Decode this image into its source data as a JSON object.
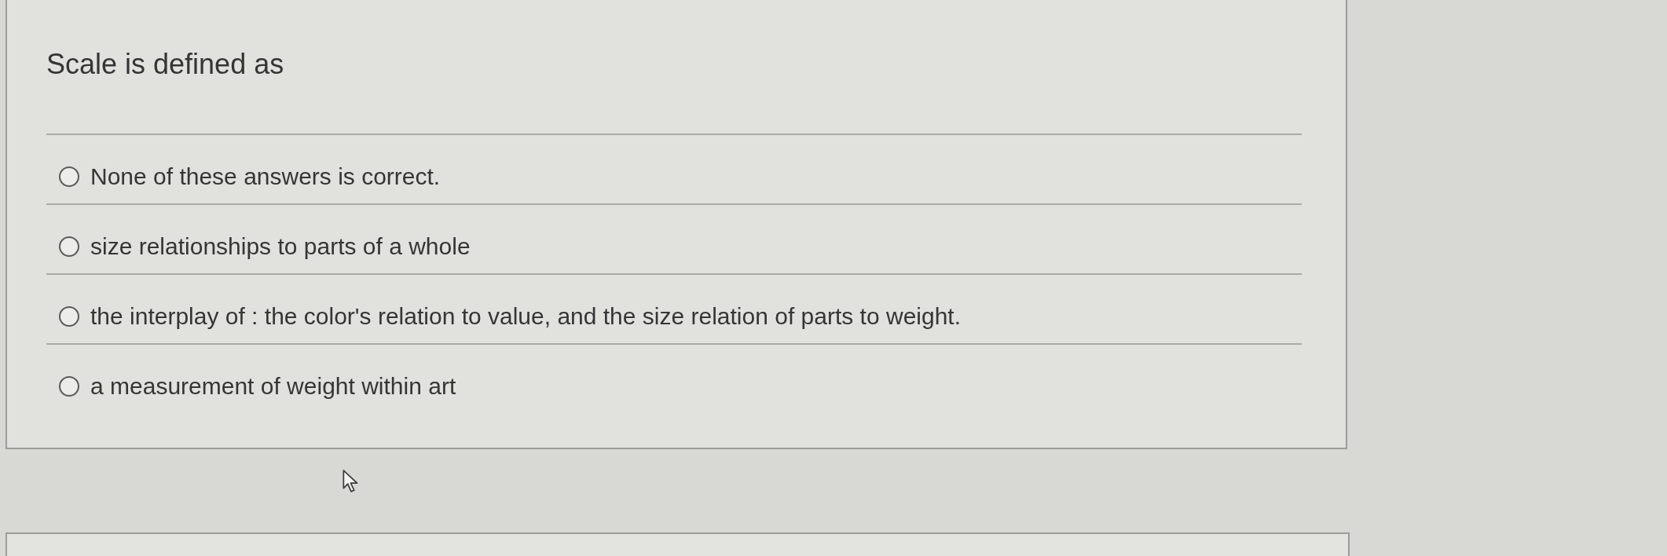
{
  "question": {
    "text": "Scale is defined as",
    "options": [
      {
        "label": "None of these answers is correct.",
        "selected": false
      },
      {
        "label": "size relationships to parts of a whole",
        "selected": false
      },
      {
        "label": "the interplay of : the color's relation to value, and the size relation of parts to weight.",
        "selected": false
      },
      {
        "label": "a measurement of weight within art",
        "selected": false
      }
    ]
  }
}
